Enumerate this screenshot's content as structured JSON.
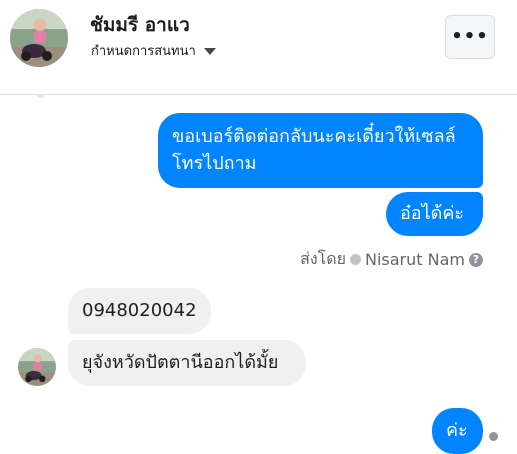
{
  "header": {
    "contact_name": "ชัมมรี อาแว",
    "subtitle": "กำหนดการสนทนา",
    "more_label": "•••"
  },
  "messages": [
    {
      "direction": "outgoing",
      "text": "ขอเบอร์ติดต่อกลับนะคะเดี๋ยวให้เซลล์โทรไปถาม"
    },
    {
      "direction": "outgoing",
      "text": "อ๋อได้ค่ะ"
    },
    {
      "direction": "incoming",
      "text": "0948020042"
    },
    {
      "direction": "incoming",
      "text": "ยุจังหวัดปัตตานีออกได้มั้ย"
    },
    {
      "direction": "outgoing",
      "text": "ค่ะ"
    }
  ],
  "sent_by": {
    "prefix": "ส่งโดย",
    "name": "Nisarut Nam",
    "help_label": "?"
  },
  "colors": {
    "outgoing_bubble": "#0084ff",
    "incoming_bubble": "#f1f0f0"
  },
  "icons": {
    "more": "more-dots-icon",
    "caret": "caret-down-icon",
    "sent_by_check": "check-circle-icon",
    "help": "help-icon",
    "seen": "seen-icon"
  }
}
